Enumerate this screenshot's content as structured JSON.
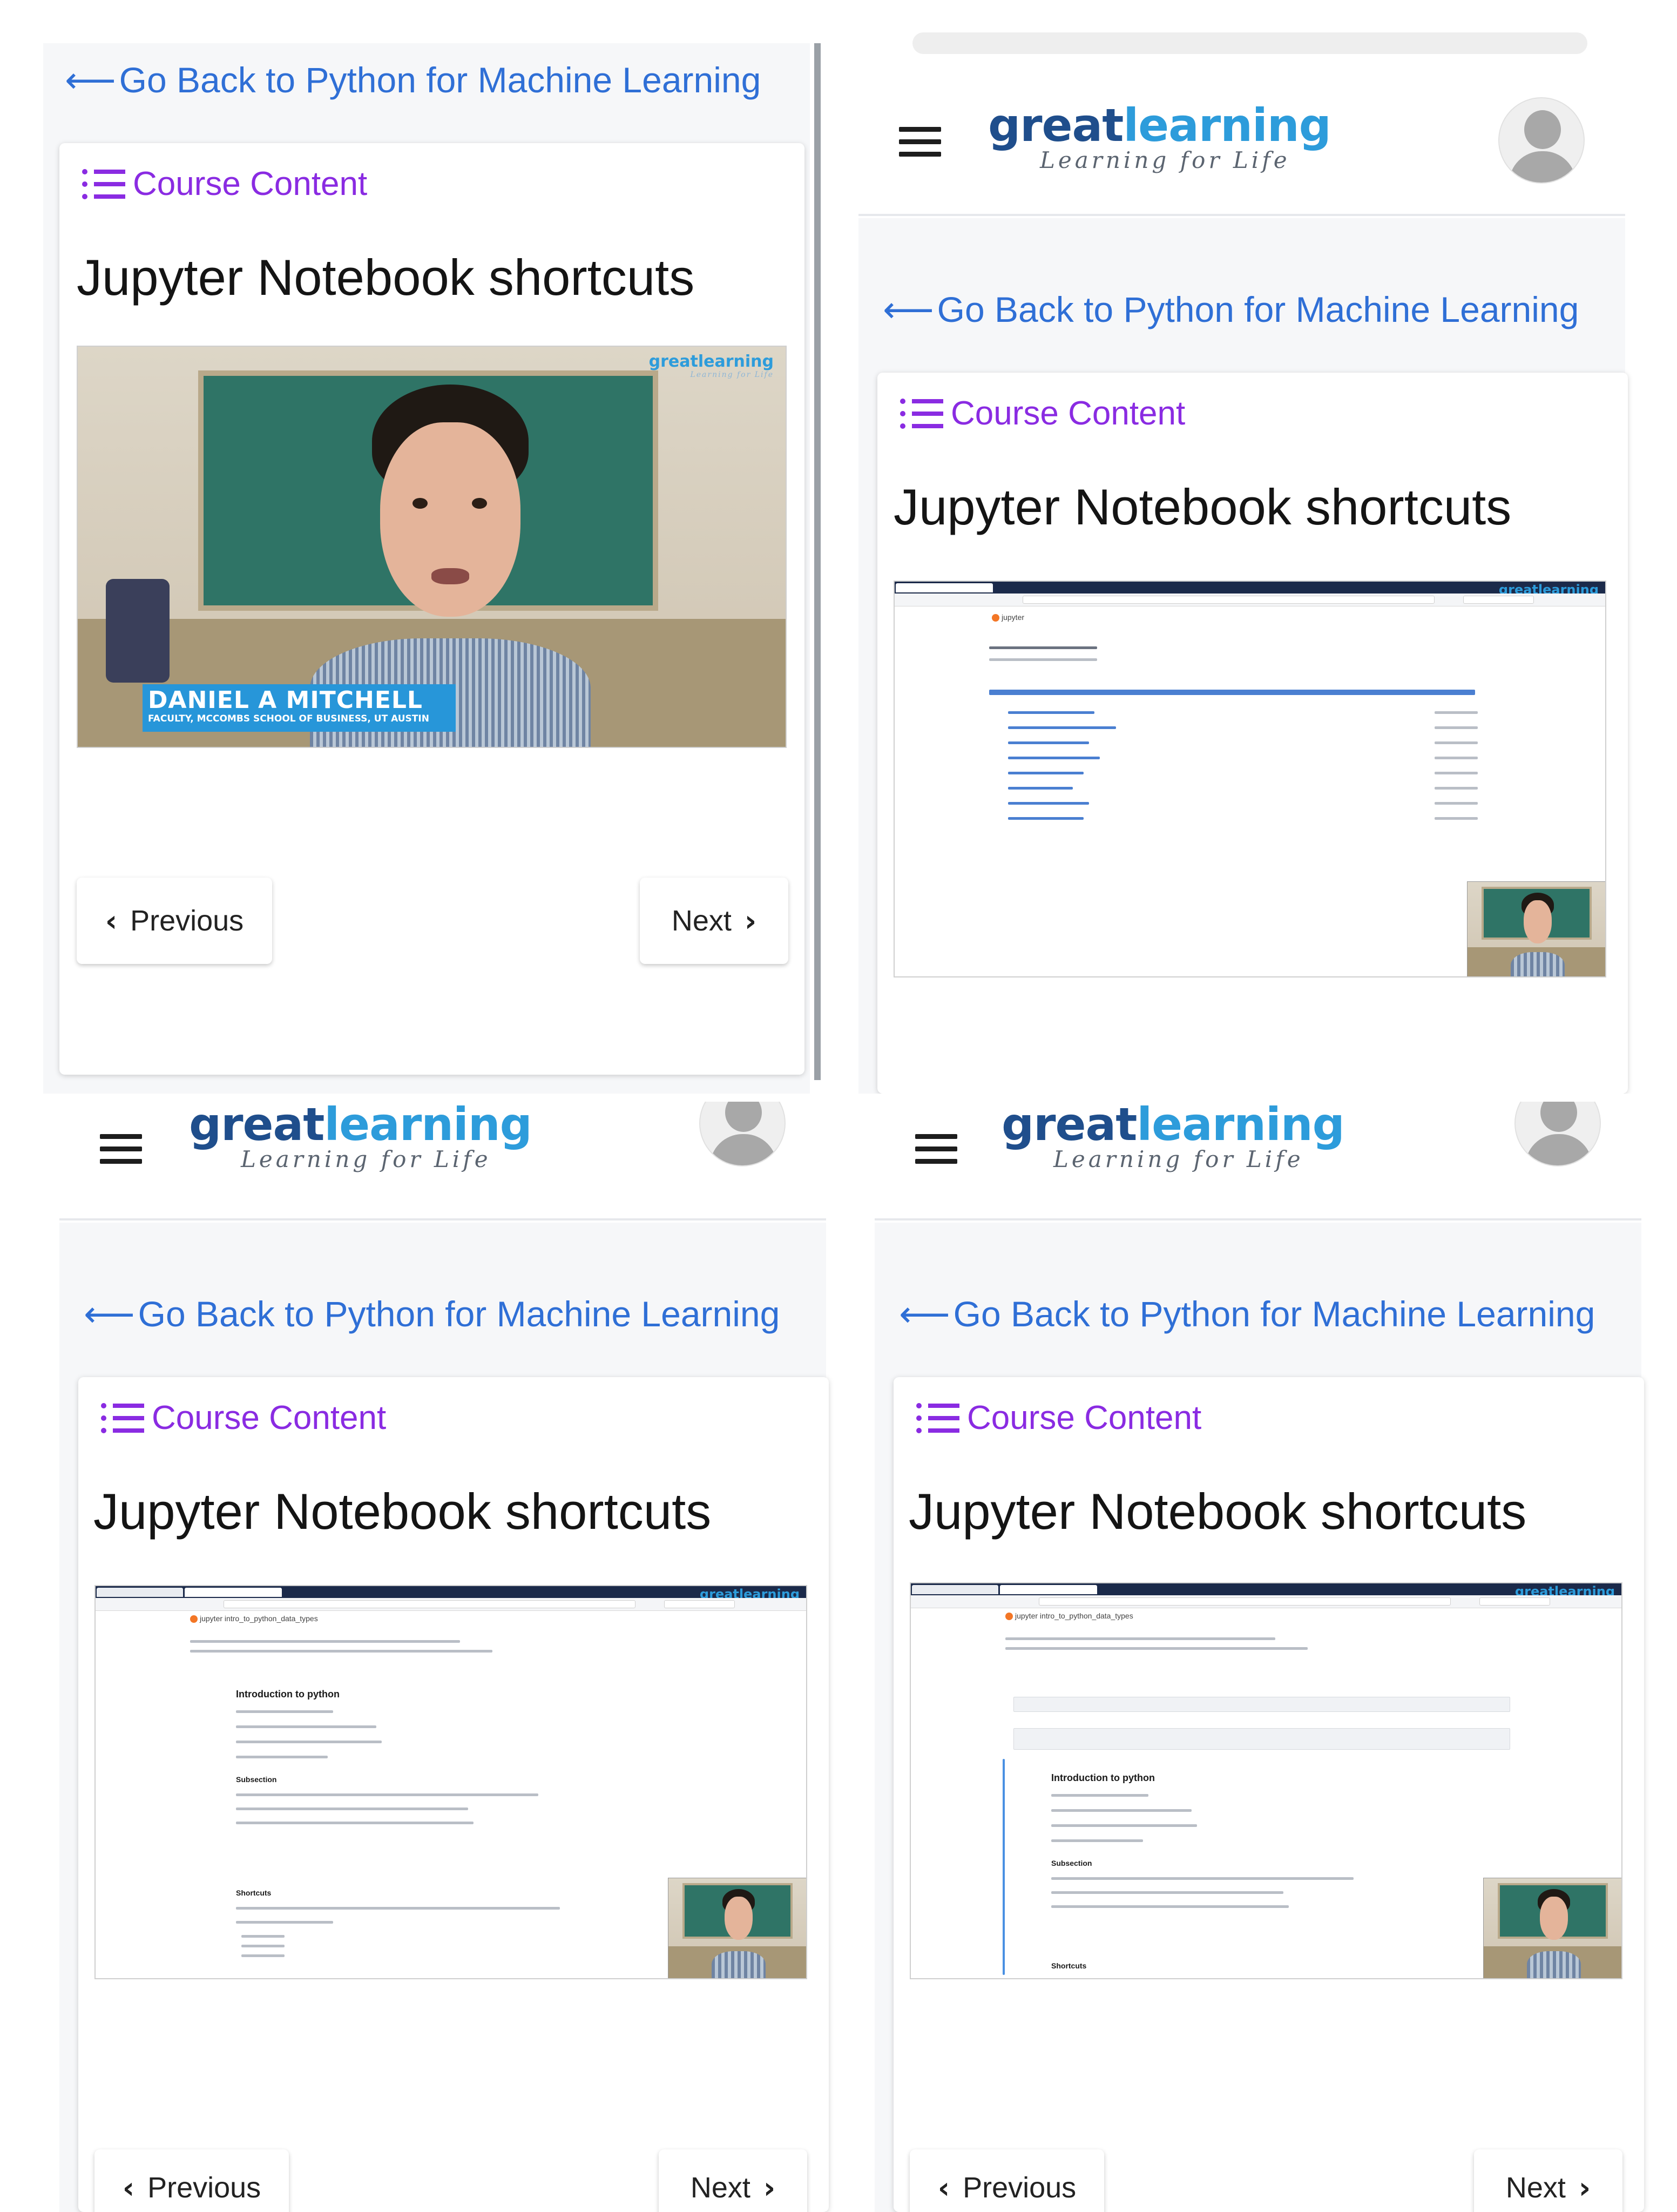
{
  "app": {
    "brand_main_a": "great",
    "brand_main_b": "learning",
    "brand_tagline": "Learning for Life",
    "accent_color": "#8a2be2",
    "link_color": "#2f6fd6",
    "brand_dark": "#1f4e8c",
    "brand_light": "#2d9cdb"
  },
  "nav": {
    "back_link": "Go Back to Python for Machine Learning",
    "course_content": "Course Content",
    "previous": "Previous",
    "next": "Next"
  },
  "lesson": {
    "title": "Jupyter Notebook shortcuts"
  },
  "video": {
    "watermark": "greatlearning",
    "watermark_tagline": "Learning for Life",
    "presenter_name": "DANIEL A MITCHELL",
    "presenter_role": "FACULTY, MCCOMBS SCHOOL OF BUSINESS, UT AUSTIN"
  },
  "notebook": {
    "app_name": "jupyter",
    "file_name": "intro_to_python_data_types",
    "heading": "Introduction to python",
    "subheading": "Subsection",
    "shortcuts_heading": "Shortcuts"
  },
  "icons": {
    "back": "arrow-left-icon",
    "menu": "hamburger-menu-icon",
    "list": "list-icon",
    "avatar": "user-avatar-icon",
    "prev": "chevron-left-icon",
    "next": "chevron-right-icon"
  }
}
